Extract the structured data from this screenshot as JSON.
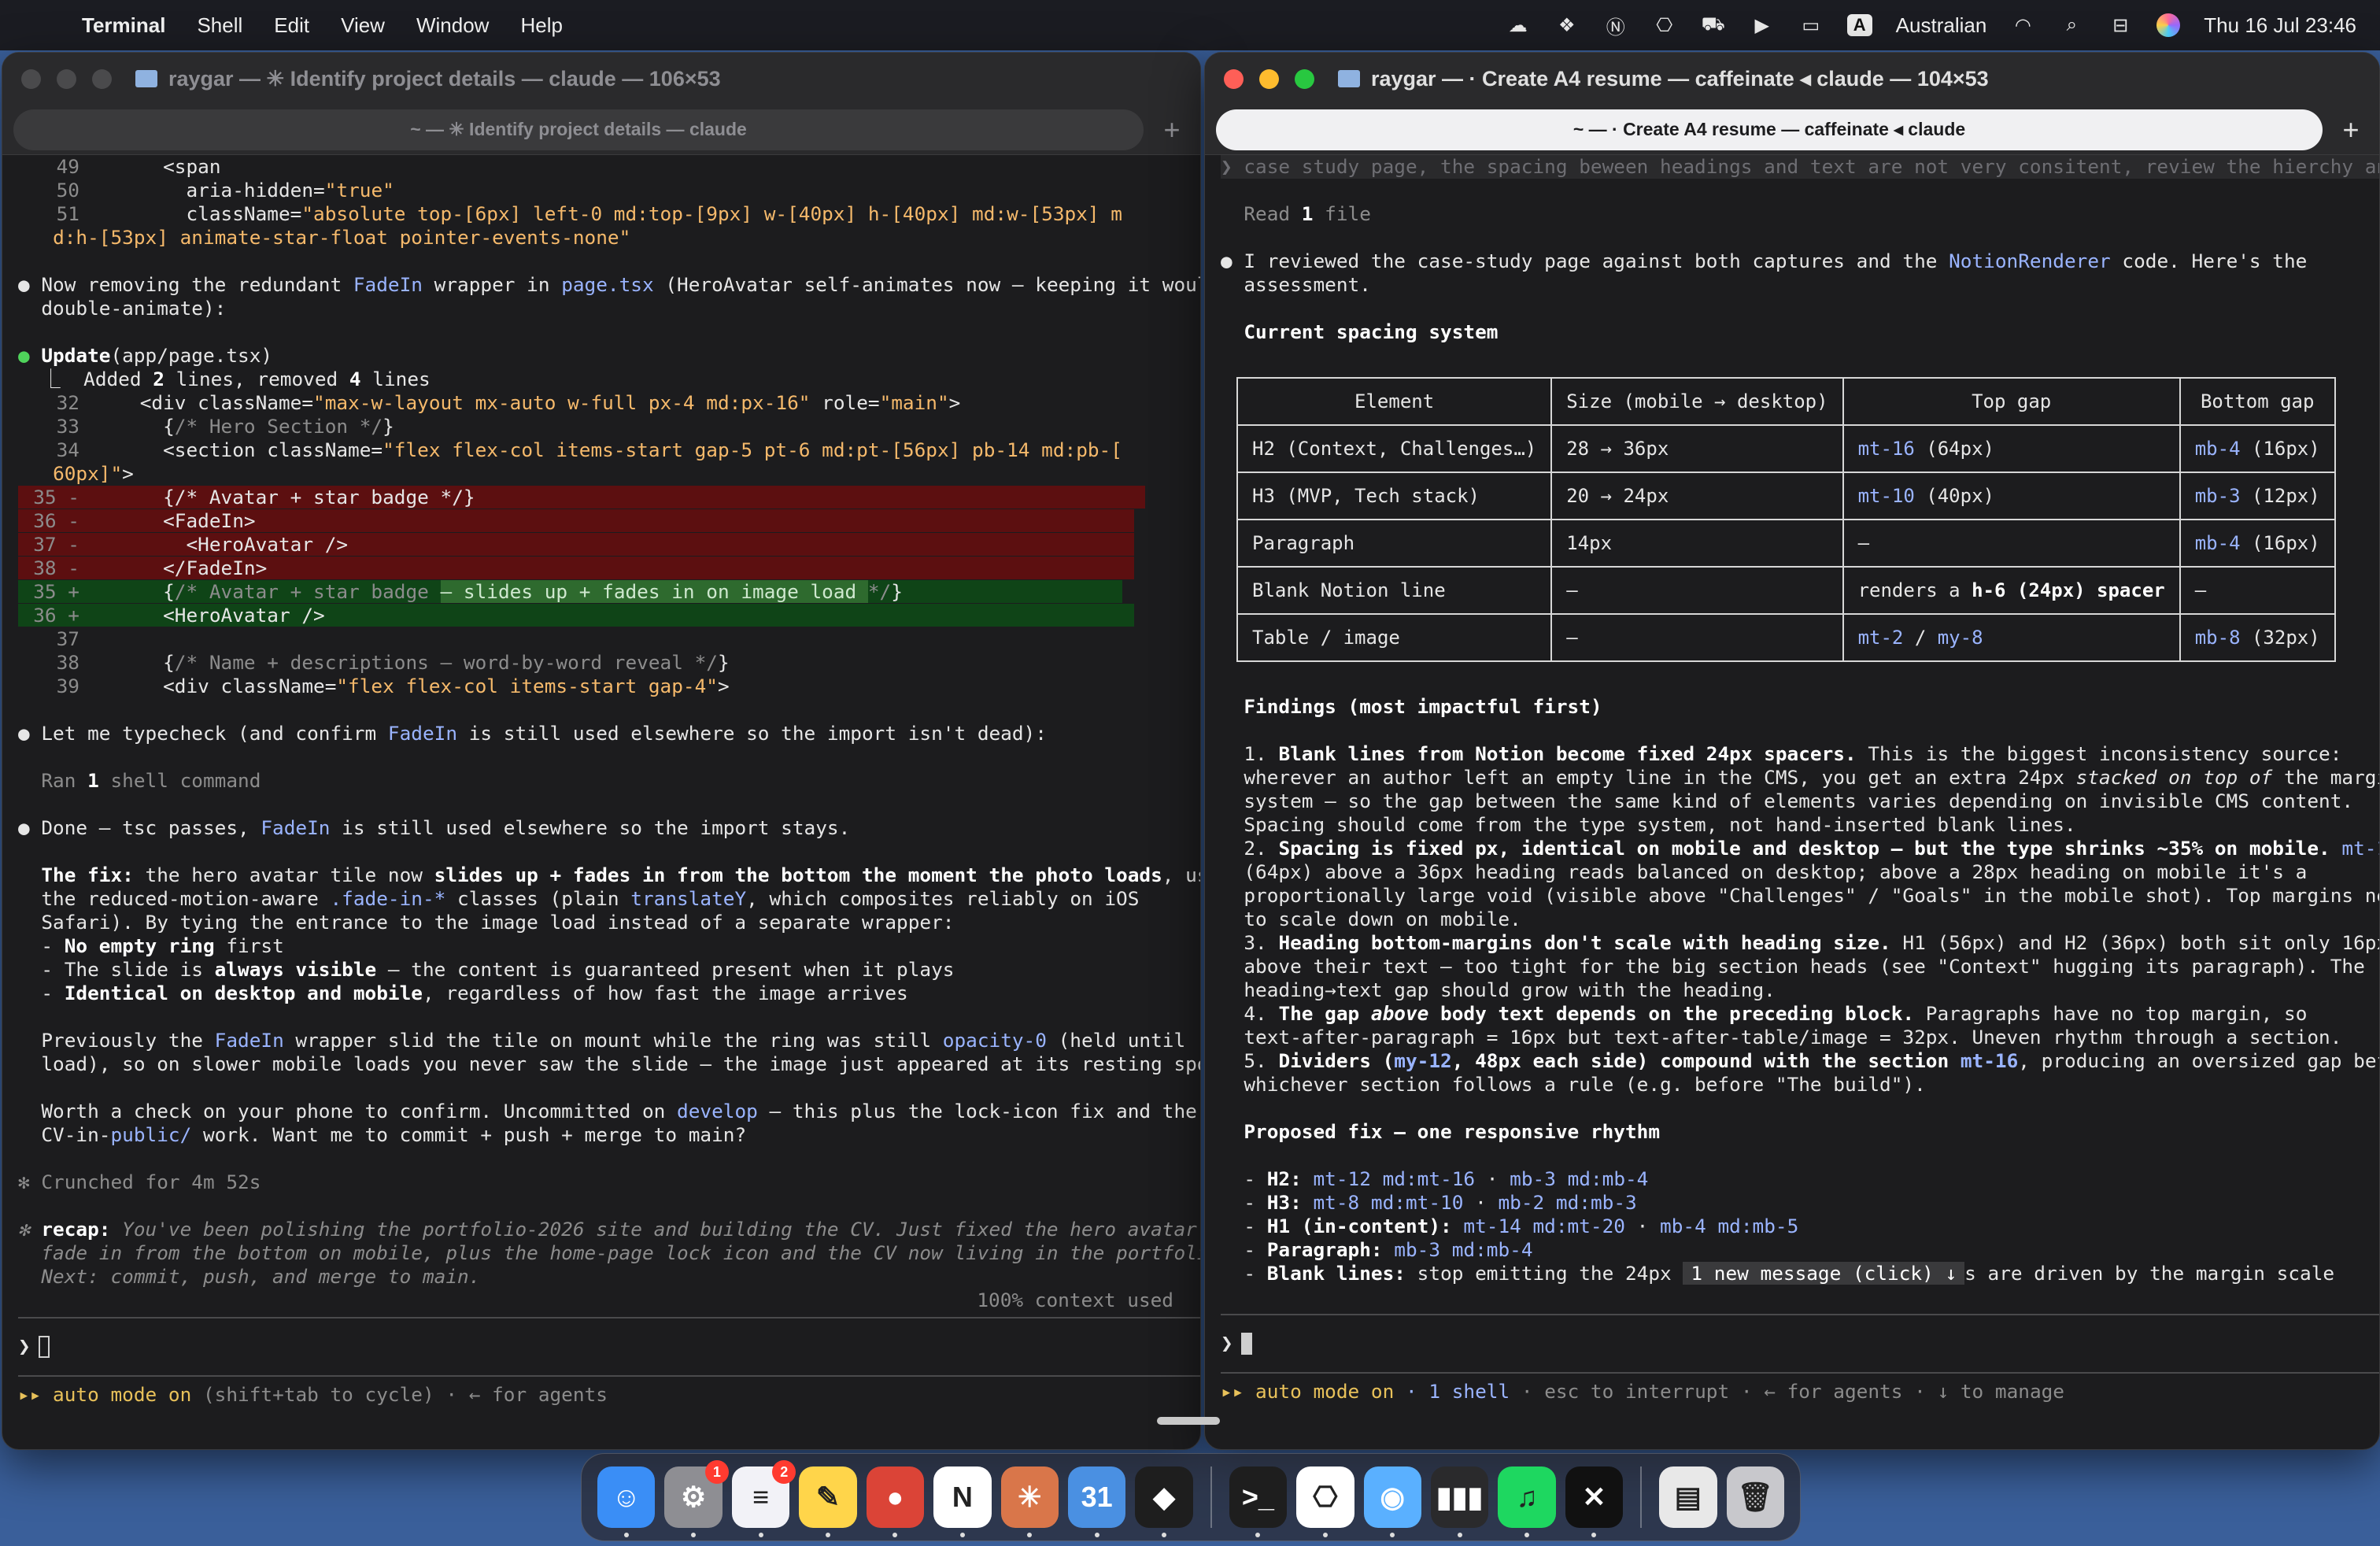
{
  "menubar": {
    "app": "Terminal",
    "items": [
      "Shell",
      "Edit",
      "View",
      "Window",
      "Help"
    ],
    "input_badge": "A",
    "input_source": "Australian",
    "datetime": "Thu 16 Jul  23:46"
  },
  "left": {
    "title": "raygar — ✳ Identify project details — claude — 106×53",
    "tab": "~ — ✳ Identify project details — claude",
    "status": "▸▸ auto mode on",
    "status_rest": " (shift+tab to cycle) · ← for agents"
  },
  "right": {
    "title": "raygar — ·  Create A4 resume — caffeinate ◂ claude — 104×53",
    "tab": "~ — ·  Create A4 resume — caffeinate ◂ claude",
    "status": "▸▸ auto mode on",
    "status_shell": " · 1 shell",
    "status_rest": " · esc to interrupt · ← for agents · ↓ to manage",
    "table": {
      "headers": [
        "Element",
        "Size (mobile → desktop)",
        "Top gap",
        "Bottom gap"
      ]
    },
    "new_message": "1 new message (click) ↓"
  },
  "dock": {
    "apps": [
      {
        "name": "finder",
        "label": "☺",
        "color": "#3a8ef6"
      },
      {
        "name": "system-settings",
        "label": "⚙",
        "color": "#8e8e93",
        "badge": "1"
      },
      {
        "name": "reminders",
        "label": "≡",
        "color": "#f2f2f7",
        "badge": "2"
      },
      {
        "name": "notes",
        "label": "✎",
        "color": "#ffd54a"
      },
      {
        "name": "chrome",
        "label": "●",
        "color": "#db4437"
      },
      {
        "name": "notion",
        "label": "N",
        "color": "#ffffff"
      },
      {
        "name": "claude",
        "label": "✳",
        "color": "#d9764a"
      },
      {
        "name": "calendar",
        "label": "31",
        "color": "#4a90e2"
      },
      {
        "name": "figma",
        "label": "◆",
        "color": "#1e1e1e"
      },
      {
        "name": "terminal",
        "label": ">_",
        "color": "#1e1e1e"
      },
      {
        "name": "chatgpt",
        "label": "⎔",
        "color": "#ffffff"
      },
      {
        "name": "helper",
        "label": "◉",
        "color": "#5ab0ff"
      },
      {
        "name": "audio-meter",
        "label": "▮▮▮",
        "color": "#2a2a2c"
      },
      {
        "name": "spotify",
        "label": "♫",
        "color": "#1ed760"
      },
      {
        "name": "capcut",
        "label": "✕",
        "color": "#111111"
      },
      {
        "name": "documents",
        "label": "▤",
        "color": "#e8e8e8"
      },
      {
        "name": "trash",
        "label": "🗑",
        "color": "#c8c8cc"
      }
    ]
  }
}
